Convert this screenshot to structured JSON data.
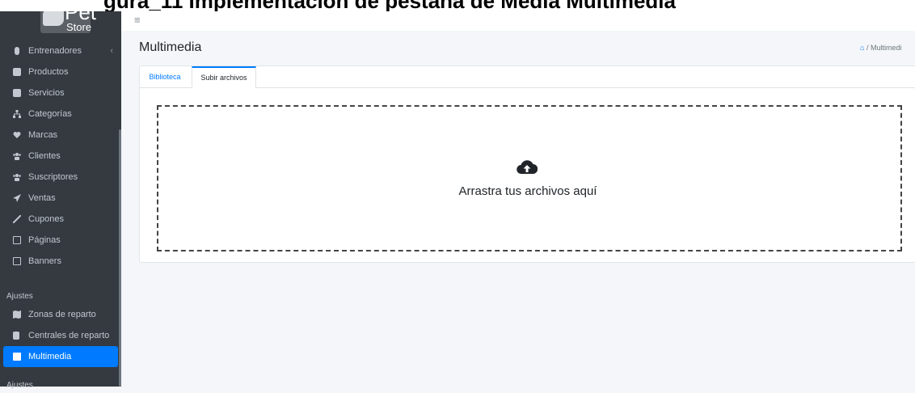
{
  "caption": {
    "text": "gura_11 Implementación de pestaña de Media Multimedia"
  },
  "logo": {
    "line1": "Pet",
    "line2": "Store"
  },
  "sidebar": {
    "items": [
      {
        "label": "Entrenadores",
        "icon": "person-icon",
        "chevron": "‹"
      },
      {
        "label": "Productos",
        "icon": "box-icon"
      },
      {
        "label": "Servicios",
        "icon": "box-icon"
      },
      {
        "label": "Categorías",
        "icon": "sitemap-icon"
      },
      {
        "label": "Marcas",
        "icon": "heart-icon"
      },
      {
        "label": "Clientes",
        "icon": "users-icon"
      },
      {
        "label": "Suscriptores",
        "icon": "users-icon"
      },
      {
        "label": "Ventas",
        "icon": "send-icon"
      },
      {
        "label": "Cupones",
        "icon": "tag-icon"
      },
      {
        "label": "Páginas",
        "icon": "file-icon"
      },
      {
        "label": "Banners",
        "icon": "image-icon"
      }
    ],
    "section1": "Ajustes",
    "items2": [
      {
        "label": "Zonas de reparto",
        "icon": "map-icon"
      },
      {
        "label": "Centrales de reparto",
        "icon": "building-icon"
      },
      {
        "label": "Multimedia",
        "icon": "image-icon",
        "active": true
      }
    ],
    "section2": "Ajustes"
  },
  "topbar": {
    "menu_icon": "≡"
  },
  "page": {
    "title": "Multimedia",
    "breadcrumb_current": "/ Multimedi",
    "home_icon": "home-icon"
  },
  "tabs": [
    {
      "label": "Biblioteca"
    },
    {
      "label": "Subir archivos",
      "active": true
    }
  ],
  "dropzone": {
    "text": "Arrastra tus archivos aquí",
    "icon": "cloud-upload-icon"
  },
  "colors": {
    "sidebar_bg": "#343a40",
    "accent": "#007bff",
    "content_bg": "#f4f6f9"
  }
}
